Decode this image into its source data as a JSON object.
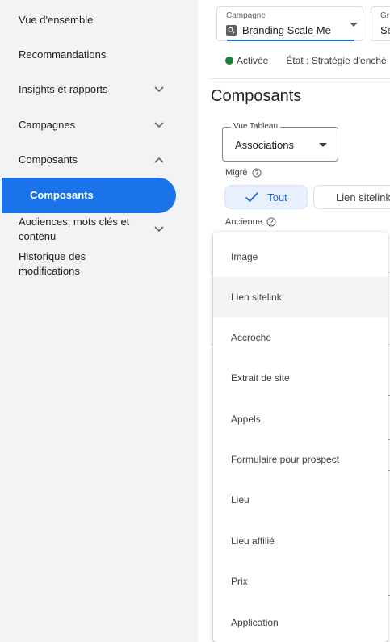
{
  "sidebar": {
    "items": [
      {
        "label": "Vue d'ensemble"
      },
      {
        "label": "Recommandations"
      },
      {
        "label": "Insights et rapports"
      },
      {
        "label": "Campagnes"
      },
      {
        "label": "Composants"
      },
      {
        "label": "Composants"
      },
      {
        "label": "Audiences, mots clés et contenu"
      },
      {
        "label": "Historique des modifications"
      }
    ]
  },
  "header": {
    "campaign_label": "Campagne",
    "campaign_value": "Branding Scale Me",
    "group_label": "Gr",
    "group_value": "Se",
    "status": "Activée",
    "state": "État : Stratégie d'enchè"
  },
  "main": {
    "title": "Composants",
    "view_select": {
      "label": "Vue Tableau",
      "value": "Associations"
    },
    "migrated_label": "Migré",
    "filters": [
      {
        "label": "Tout"
      },
      {
        "label": "Lien sitelink"
      }
    ],
    "legacy_label": "Ancienne"
  },
  "menu": {
    "items": [
      {
        "label": "Image"
      },
      {
        "label": "Lien sitelink"
      },
      {
        "label": "Accroche"
      },
      {
        "label": "Extrait de site"
      },
      {
        "label": "Appels"
      },
      {
        "label": "Formulaire pour prospect"
      },
      {
        "label": "Lieu"
      },
      {
        "label": "Lieu affilié"
      },
      {
        "label": "Prix"
      },
      {
        "label": "Application"
      }
    ]
  },
  "colors": {
    "accent": "#1a73e8",
    "status_green": "#188038",
    "sidebar_bg": "#f1f3f4"
  }
}
